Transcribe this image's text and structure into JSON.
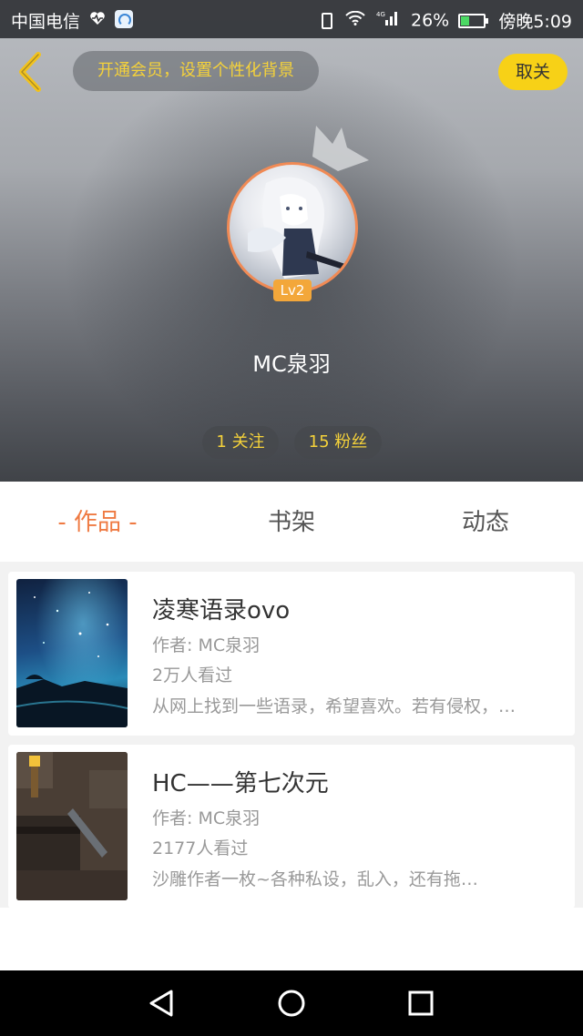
{
  "status_bar": {
    "carrier": "中国电信",
    "battery": "26%",
    "time": "傍晚5:09"
  },
  "header": {
    "vip_prompt": "开通会员，设置个性化背景",
    "unfollow_label": "取关",
    "level": "Lv2",
    "username": "MC泉羽",
    "following": "1 关注",
    "followers": "15 粉丝"
  },
  "tabs": [
    {
      "label": "- 作品 -",
      "active": true
    },
    {
      "label": "书架",
      "active": false
    },
    {
      "label": "动态",
      "active": false
    }
  ],
  "works": [
    {
      "title": "凌寒语录ovo",
      "author": "作者: MC泉羽",
      "views": "2万人看过",
      "description": "从网上找到一些语录，希望喜欢。若有侵权，…"
    },
    {
      "title": "HC——第七次元",
      "author": "作者: MC泉羽",
      "views": "2177人看过",
      "description": "沙雕作者一枚~各种私设，乱入，还有拖…"
    }
  ],
  "colors": {
    "accent_orange": "#ef7a42",
    "accent_yellow": "#f7d117",
    "vip_text": "#f5d23a"
  }
}
